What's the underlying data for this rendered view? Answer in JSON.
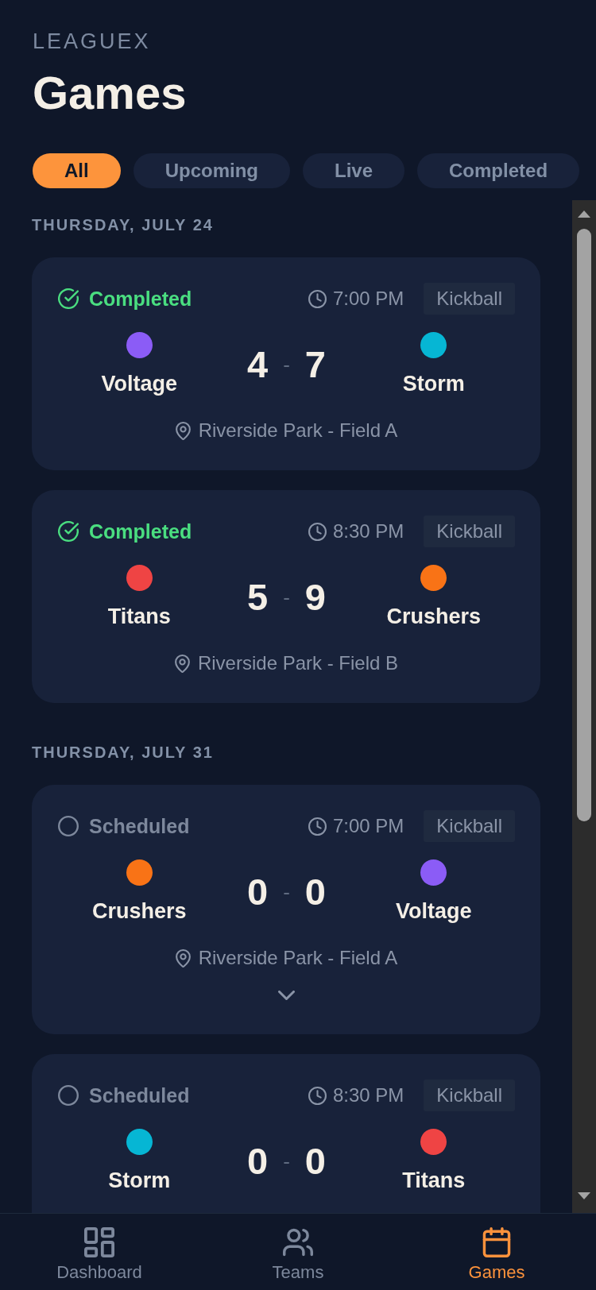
{
  "app": {
    "brand": "LEAGUEX",
    "title": "Games"
  },
  "tabs": [
    {
      "label": "All",
      "selected": true
    },
    {
      "label": "Upcoming",
      "selected": false
    },
    {
      "label": "Live",
      "selected": false
    },
    {
      "label": "Completed",
      "selected": false
    }
  ],
  "sections": [
    {
      "date": "THURSDAY, JULY 24",
      "games": [
        {
          "status": {
            "kind": "completed",
            "label": "Completed"
          },
          "time": "7:00 PM",
          "sport": "Kickball",
          "home": {
            "name": "Voltage",
            "color": "#8b5cf6",
            "score": "4"
          },
          "separator": "-",
          "away": {
            "name": "Storm",
            "color": "#06b6d4",
            "score": "7"
          },
          "location": "Riverside Park - Field A",
          "expandable": false
        },
        {
          "status": {
            "kind": "completed",
            "label": "Completed"
          },
          "time": "8:30 PM",
          "sport": "Kickball",
          "home": {
            "name": "Titans",
            "color": "#ef4444",
            "score": "5"
          },
          "separator": "-",
          "away": {
            "name": "Crushers",
            "color": "#f97316",
            "score": "9"
          },
          "location": "Riverside Park - Field B",
          "expandable": false
        }
      ]
    },
    {
      "date": "THURSDAY, JULY 31",
      "games": [
        {
          "status": {
            "kind": "scheduled",
            "label": "Scheduled"
          },
          "time": "7:00 PM",
          "sport": "Kickball",
          "home": {
            "name": "Crushers",
            "color": "#f97316",
            "score": "0"
          },
          "separator": "-",
          "away": {
            "name": "Voltage",
            "color": "#8b5cf6",
            "score": "0"
          },
          "location": "Riverside Park - Field A",
          "expandable": true
        },
        {
          "status": {
            "kind": "scheduled",
            "label": "Scheduled"
          },
          "time": "8:30 PM",
          "sport": "Kickball",
          "home": {
            "name": "Storm",
            "color": "#06b6d4",
            "score": "0"
          },
          "separator": "-",
          "away": {
            "name": "Titans",
            "color": "#ef4444",
            "score": "0"
          },
          "expandable": false
        }
      ]
    }
  ],
  "bottom_nav": [
    {
      "label": "Dashboard",
      "selected": false
    },
    {
      "label": "Teams",
      "selected": false
    },
    {
      "label": "Games",
      "selected": true
    }
  ]
}
